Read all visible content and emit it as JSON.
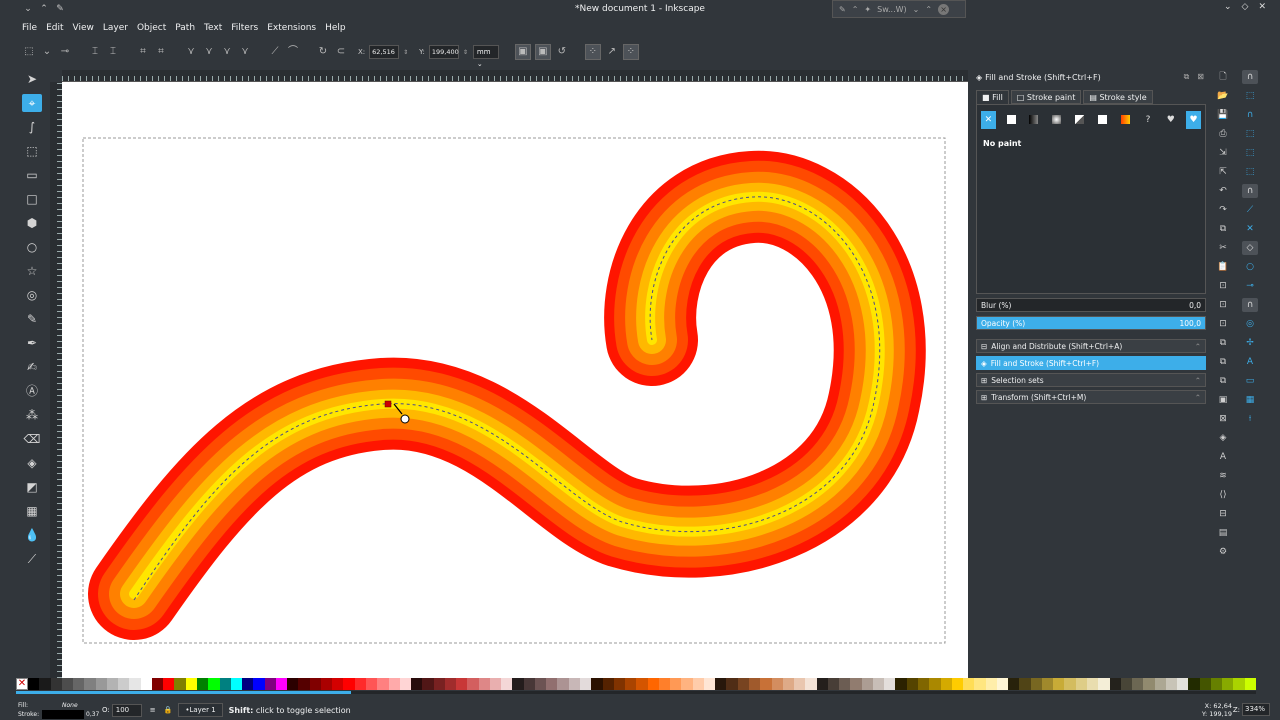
{
  "window": {
    "title": "*New document 1 - Inkscape",
    "popup_label": "Sw...W)"
  },
  "menu": [
    "File",
    "Edit",
    "View",
    "Layer",
    "Object",
    "Path",
    "Text",
    "Filters",
    "Extensions",
    "Help"
  ],
  "tool_controls": {
    "x_label": "X:",
    "x_value": "62,516",
    "y_label": "Y:",
    "y_value": "199,400",
    "unit": "mm"
  },
  "fill_stroke": {
    "dock_title": "Fill and Stroke (Shift+Ctrl+F)",
    "tabs": [
      "Fill",
      "Stroke paint",
      "Stroke style"
    ],
    "paint_status": "No paint",
    "blur_label": "Blur (%)",
    "blur_value": "0,0",
    "opacity_label": "Opacity (%)",
    "opacity_value": "100,0",
    "opacity_fraction": 1.0
  },
  "dock_items": [
    {
      "label": "Align and Distribute (Shift+Ctrl+A)",
      "active": false
    },
    {
      "label": "Fill and Stroke (Shift+Ctrl+F)",
      "active": true
    },
    {
      "label": "Selection sets",
      "active": false
    },
    {
      "label": "Transform (Shift+Ctrl+M)",
      "active": false
    }
  ],
  "status": {
    "fill_label": "Fill:",
    "fill_value": "None",
    "stroke_label": "Stroke:",
    "stroke_width": "0,37",
    "opacity_label": "O:",
    "opacity_value": "100",
    "layer": "•Layer 1",
    "message_key": "Shift:",
    "message_text": " click to toggle selection",
    "x_label": "X:",
    "x_value": "62,64",
    "y_label": "Y:",
    "y_value": "199,19",
    "zoom_label": "Z:",
    "zoom_value": "334%"
  },
  "palette_colors": [
    "#000000",
    "#1a1a1a",
    "#333333",
    "#4d4d4d",
    "#666666",
    "#808080",
    "#999999",
    "#b3b3b3",
    "#cccccc",
    "#e6e6e6",
    "#ffffff",
    "#800000",
    "#ff0000",
    "#808000",
    "#ffff00",
    "#008000",
    "#00ff00",
    "#008080",
    "#00ffff",
    "#000080",
    "#0000ff",
    "#800080",
    "#ff00ff",
    "#2b0000",
    "#550000",
    "#800000",
    "#aa0000",
    "#d40000",
    "#ff0000",
    "#ff2a2a",
    "#ff5555",
    "#ff8080",
    "#ffaaaa",
    "#ffd5d5",
    "#280b0b",
    "#501616",
    "#782121",
    "#a02c2c",
    "#c83737",
    "#d35f5f",
    "#de8787",
    "#e9afaf",
    "#f4d7d7",
    "#241c1c",
    "#483737",
    "#6c5353",
    "#916f6f",
    "#ac9393",
    "#c8b7b7",
    "#e3dbdb",
    "#2b1100",
    "#552200",
    "#803300",
    "#aa4400",
    "#d45500",
    "#ff6600",
    "#ff7f2a",
    "#ff9955",
    "#ffb380",
    "#ffccaa",
    "#ffe6d5",
    "#28170b",
    "#502d16",
    "#784421",
    "#a05a2c",
    "#c87137",
    "#d38d5f",
    "#deaa87",
    "#e9c6af",
    "#f4e3d7",
    "#241f1c",
    "#483e37",
    "#6c5d53",
    "#917c6f",
    "#ac9d93",
    "#c8beb7",
    "#e3dedb",
    "#2b2200",
    "#554400",
    "#806600",
    "#aa8800",
    "#d4aa00",
    "#ffcc00",
    "#ffdd55",
    "#ffe680",
    "#ffeeaa",
    "#fff6d5",
    "#28220b",
    "#504416",
    "#786721",
    "#a0892c",
    "#c8ab37",
    "#d3bc5f",
    "#decd87",
    "#e9ddaf",
    "#f4eed7",
    "#24221c",
    "#484537",
    "#6c6753",
    "#918a6f",
    "#aca793",
    "#c8c4b7",
    "#e3e2db",
    "#222b00",
    "#445500",
    "#668000",
    "#88aa00",
    "#aad400",
    "#ccff00"
  ],
  "icons": {
    "tools": [
      "selector-icon",
      "node-icon",
      "tweak-icon",
      "zoom-icon",
      "measure-icon",
      "rect-icon",
      "box3d-icon",
      "ellipse-icon",
      "star-icon",
      "spiral-icon",
      "pencil-icon",
      "pen-icon",
      "calligraphy-icon",
      "text-icon",
      "spray-icon",
      "eraser-icon",
      "bucket-icon",
      "gradient-icon",
      "mesh-icon",
      "dropper-icon",
      "connector-icon"
    ]
  }
}
